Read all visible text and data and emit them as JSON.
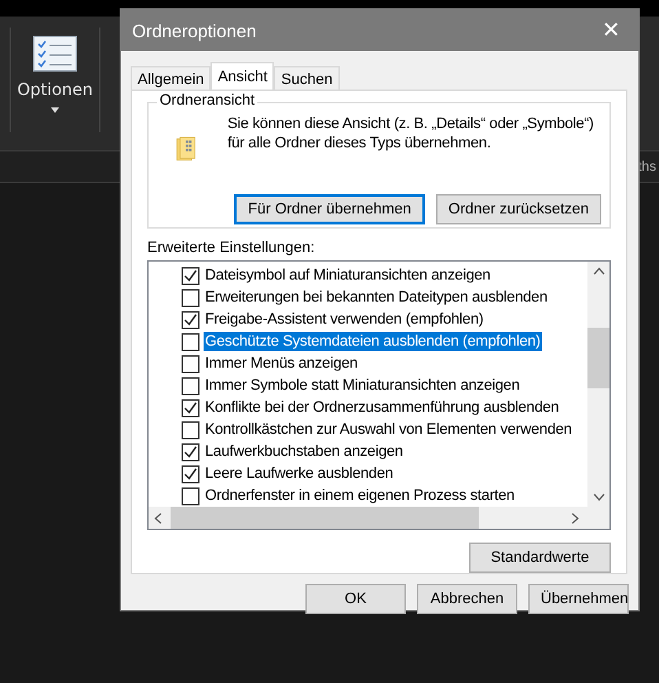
{
  "ribbon": {
    "button_label": "Optionen",
    "search_fragment": "ths"
  },
  "dialog": {
    "title": "Ordneroptionen",
    "close": "✕",
    "tabs": [
      {
        "label": "Allgemein",
        "selected": false
      },
      {
        "label": "Ansicht",
        "selected": true
      },
      {
        "label": "Suchen",
        "selected": false
      }
    ],
    "folder_view": {
      "legend": "Ordneransicht",
      "description": "Sie können diese Ansicht (z. B. „Details“ oder „Symbole“) für alle Ordner dieses Typs übernehmen.",
      "buttons": [
        {
          "label": "Für Ordner übernehmen",
          "focused": true
        },
        {
          "label": "Ordner zurücksetzen",
          "focused": false
        }
      ]
    },
    "advanced": {
      "label": "Erweiterte Einstellungen:",
      "items": [
        {
          "label": "Dateisymbol auf Miniaturansichten anzeigen",
          "checked": true,
          "selected": false
        },
        {
          "label": "Erweiterungen bei bekannten Dateitypen ausblenden",
          "checked": false,
          "selected": false
        },
        {
          "label": "Freigabe-Assistent verwenden (empfohlen)",
          "checked": true,
          "selected": false
        },
        {
          "label": "Geschützte Systemdateien ausblenden (empfohlen)",
          "checked": false,
          "selected": true
        },
        {
          "label": "Immer Menüs anzeigen",
          "checked": false,
          "selected": false
        },
        {
          "label": "Immer Symbole statt Miniaturansichten anzeigen",
          "checked": false,
          "selected": false
        },
        {
          "label": "Konflikte bei der Ordnerzusammenführung ausblenden",
          "checked": true,
          "selected": false
        },
        {
          "label": "Kontrollkästchen zur Auswahl von Elementen verwenden",
          "checked": false,
          "selected": false
        },
        {
          "label": "Laufwerkbuchstaben anzeigen",
          "checked": true,
          "selected": false
        },
        {
          "label": "Leere Laufwerke ausblenden",
          "checked": true,
          "selected": false
        },
        {
          "label": "Ordnerfenster in einem eigenen Prozess starten",
          "checked": false,
          "selected": false
        }
      ],
      "defaults_button": "Standardwerte"
    },
    "buttons": [
      "OK",
      "Abbrechen",
      "Übernehmen"
    ]
  }
}
